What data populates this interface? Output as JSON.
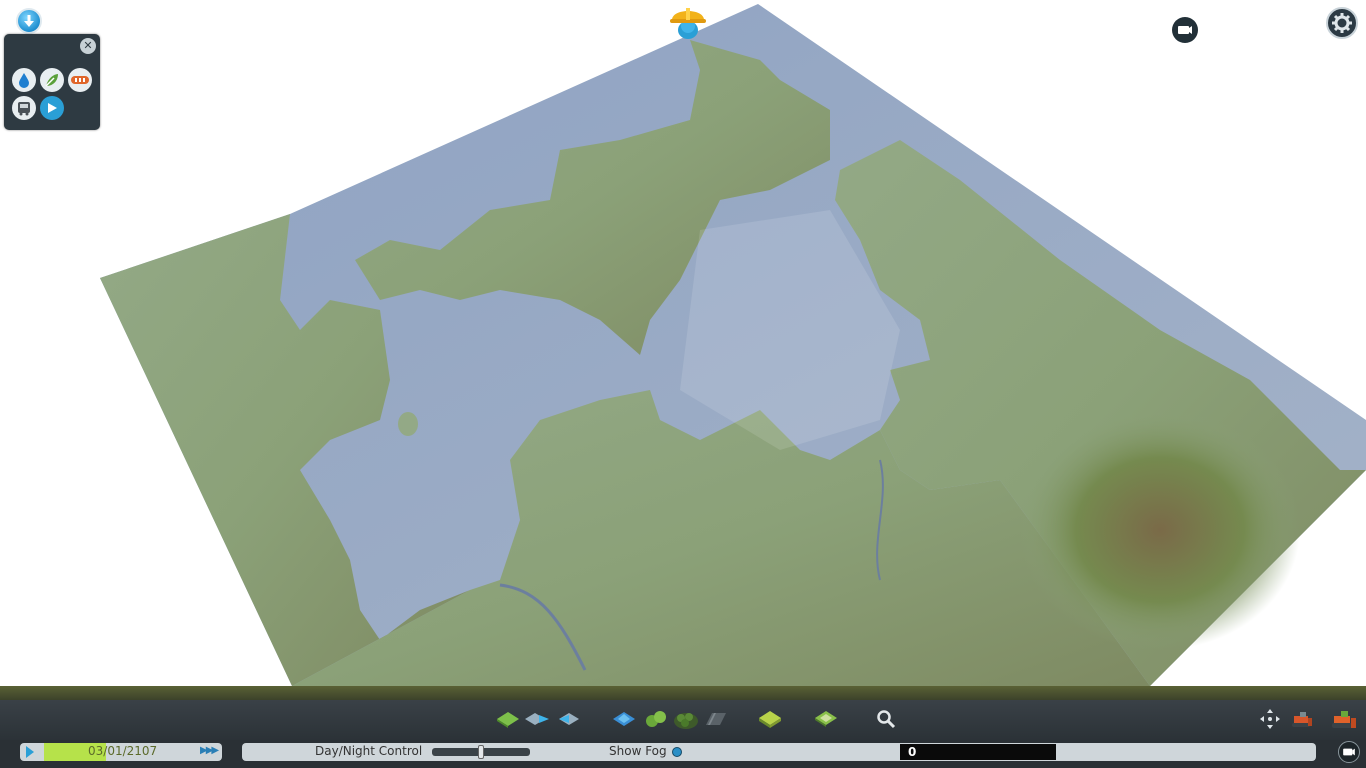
{
  "top_bar": {
    "info_icon": "info-icon",
    "unlock_icon": "chirper-hardhat-icon",
    "camera_icon": "camera-icon",
    "settings_icon": "gear-icon"
  },
  "info_panel": {
    "close_icon": "close-icon",
    "close_label": "✕",
    "icons": [
      "water-drop-icon",
      "leaf-pollution-icon",
      "road-traffic-icon",
      "bus-transport-icon",
      "arrow-direction-icon"
    ]
  },
  "toolbar": {
    "tools": [
      "terrain-level-icon",
      "water-shift-icon",
      "water-shift-alt-icon",
      "water-source-icon",
      "trees-icon",
      "forest-brush-icon",
      "road-shape-icon",
      "land-square-icon",
      "land-dots-icon",
      "magnifier-icon"
    ],
    "right_tools": [
      "move-arrows-icon",
      "bulldozer-icon",
      "bulldozer-active-icon"
    ]
  },
  "status_bar": {
    "date": "03/01/2107",
    "progress": 0.35,
    "day_night_label": "Day/Night Control",
    "day_night_value": 0.5,
    "show_fog_label": "Show Fog",
    "value_box": "0"
  },
  "colors": {
    "water": "#97a8c3",
    "land": "#8da07a",
    "toolbar": "#2e353b",
    "accent": "#2a9fd6",
    "time_progress": "#b6e24a"
  }
}
